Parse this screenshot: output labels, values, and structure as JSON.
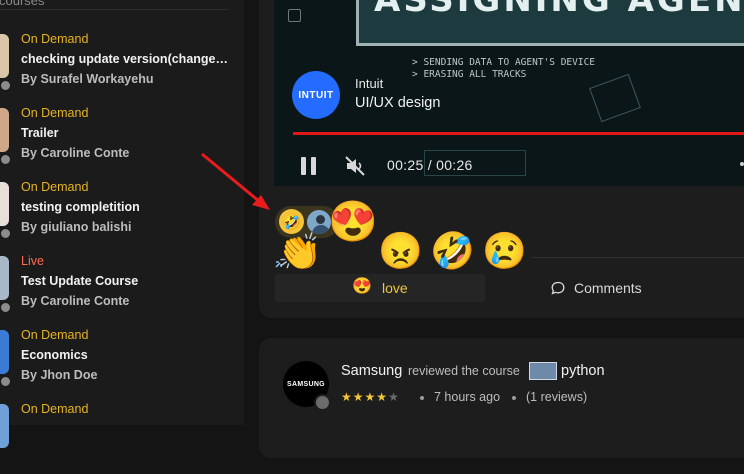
{
  "sidebar": {
    "header": "courses",
    "items": [
      {
        "status": "On Demand",
        "title": "checking update version(changed...",
        "by_label": "By",
        "author": "Surafel Workayehu",
        "thumb_color": "#d9c6a6"
      },
      {
        "status": "On Demand",
        "title": "Trailer",
        "by_label": "By",
        "author": "Caroline Conte",
        "thumb_color": "#cfa88a"
      },
      {
        "status": "On Demand",
        "title": "testing completition",
        "by_label": "By",
        "author": "giuliano balishi",
        "thumb_color": "#e8e0d8"
      },
      {
        "status": "Live",
        "title": "Test Update Course",
        "by_label": "By",
        "author": "Caroline Conte",
        "thumb_color": "#a8b8c8"
      },
      {
        "status": "On Demand",
        "title": "Economics",
        "by_label": "By",
        "author": "Jhon Doe",
        "thumb_color": "#3b7bd6"
      },
      {
        "status": "On Demand",
        "title": "",
        "by_label": "",
        "author": "",
        "thumb_color": "#6fa0d8"
      }
    ]
  },
  "post": {
    "video": {
      "banner_text": "ASSIGNING AGENT",
      "line1": "> SENDING DATA TO AGENT'S DEVICE",
      "line2": "> ERASING ALL TRACKS"
    },
    "channel_name": "Intuit",
    "channel_logo_text": "INTUIT",
    "course_name": "UI/UX design",
    "time_display": "00:25 / 00:26",
    "progress_fraction": 0.96,
    "reactions": {
      "summary_emoji": "🤣",
      "picker": [
        "😍",
        "👏",
        "😠",
        "🤣",
        "😢"
      ],
      "selected_emoji": "😍",
      "selected_label": "love"
    },
    "comments_label": "Comments"
  },
  "review": {
    "logo_text": "SAMSUNG",
    "reviewer": "Samsung",
    "action": "reviewed the course",
    "course": "python",
    "rating": 4,
    "max_rating": 5,
    "time_ago": "7 hours ago",
    "review_count": "(1 reviews)"
  },
  "colors": {
    "accent": "#f0c542",
    "live": "#ff6a4d",
    "progress": "#e01818",
    "arrow": "#e81c1c",
    "intuit_blue": "#236cff"
  }
}
